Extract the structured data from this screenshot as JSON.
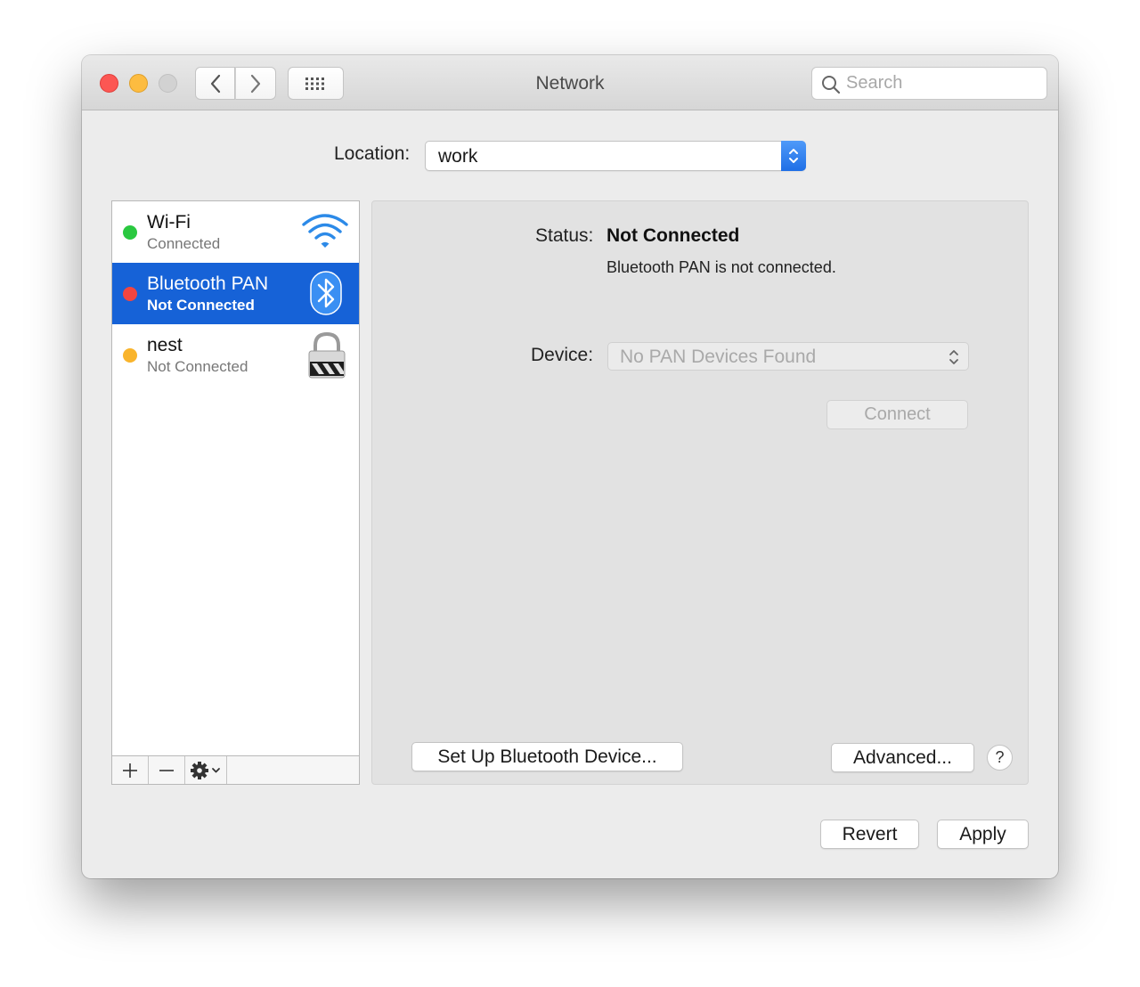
{
  "window": {
    "title": "Network",
    "search_placeholder": "Search"
  },
  "location": {
    "label": "Location:",
    "value": "work"
  },
  "services": [
    {
      "name": "Wi-Fi",
      "status": "Connected",
      "status_color": "#2ac840",
      "icon": "wifi-icon"
    },
    {
      "name": "Bluetooth PAN",
      "status": "Not Connected",
      "status_color": "#f2453f",
      "icon": "bluetooth-icon",
      "selected": true
    },
    {
      "name": "nest",
      "status": "Not Connected",
      "status_color": "#f9b42c",
      "icon": "vpn-lock-icon"
    }
  ],
  "detail": {
    "status_label": "Status:",
    "status_value": "Not Connected",
    "status_description": "Bluetooth PAN is not connected.",
    "device_label": "Device:",
    "device_value": "No PAN Devices Found",
    "connect_label": "Connect",
    "setup_label": "Set Up Bluetooth Device...",
    "advanced_label": "Advanced...",
    "help_label": "?"
  },
  "footer": {
    "revert_label": "Revert",
    "apply_label": "Apply"
  },
  "colors": {
    "accent": "#1662d7",
    "select_arrow": "#2a78ef"
  }
}
